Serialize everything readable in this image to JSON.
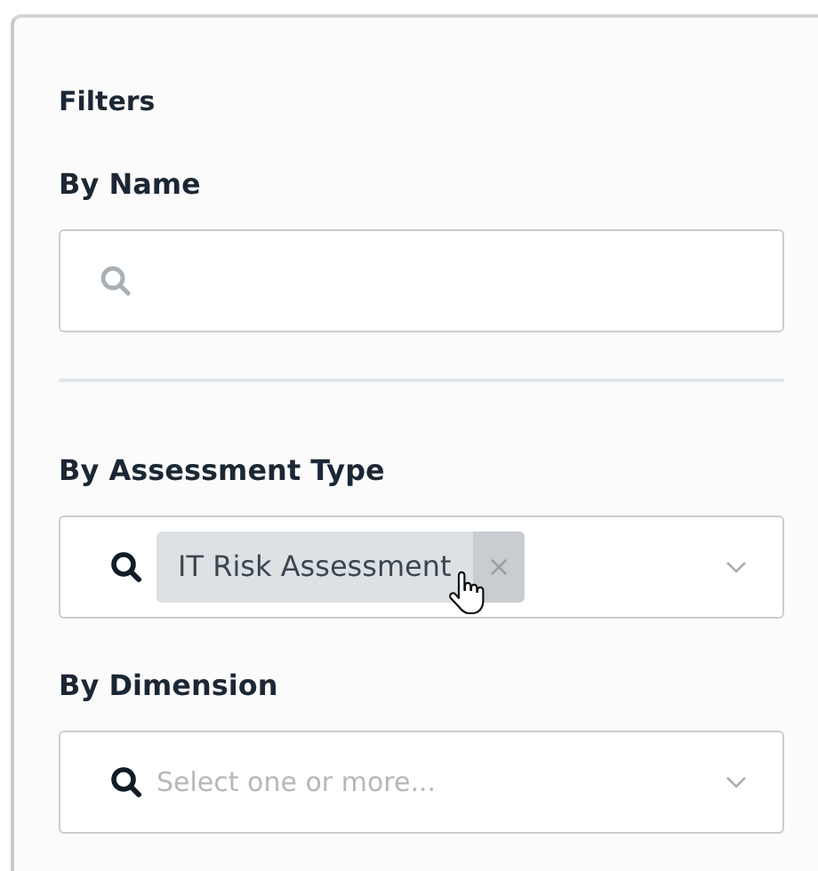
{
  "panel": {
    "title": "Filters"
  },
  "name_filter": {
    "label": "By Name"
  },
  "assessment_type_filter": {
    "label": "By Assessment Type",
    "tags": [
      {
        "label": "IT Risk Assessment",
        "remove": "×",
        "hovered": true
      }
    ]
  },
  "dimension_filter": {
    "label": "By Dimension",
    "placeholder": "Select one or more..."
  }
}
